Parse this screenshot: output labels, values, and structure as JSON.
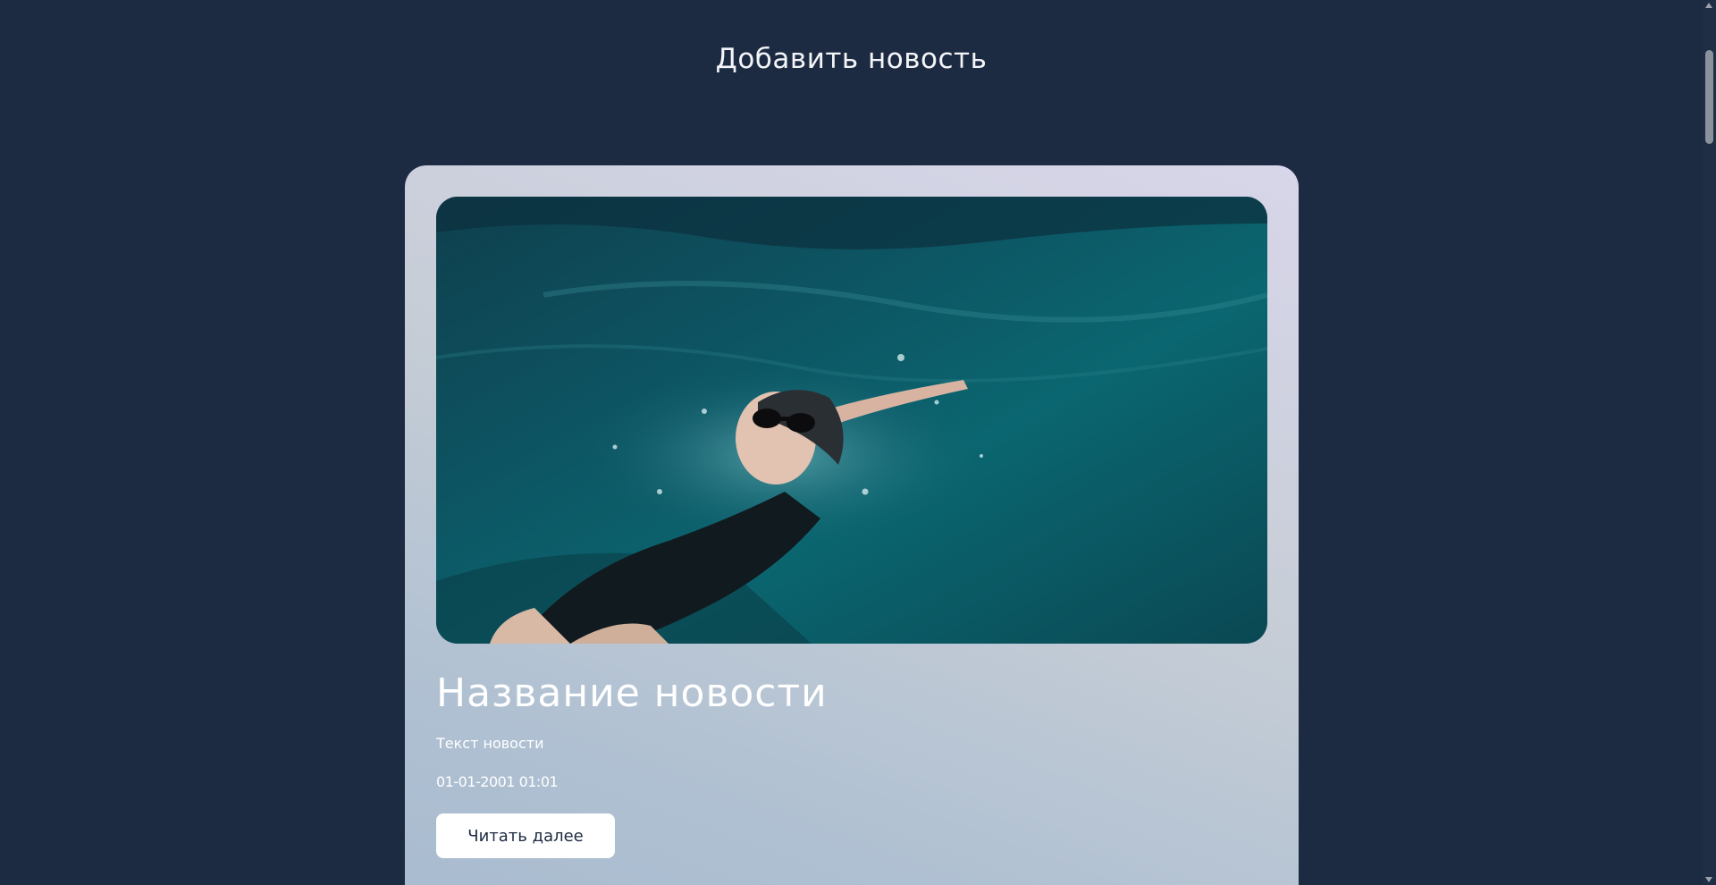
{
  "header": {
    "add_news_label": "Добавить новость"
  },
  "news_card": {
    "image_icon": "swimmer-photo",
    "title": "Название новости",
    "text": "Текст новости",
    "date": "01-01-2001 01:01",
    "read_more_label": "Читать далее"
  },
  "colors": {
    "background": "#1d2b42",
    "card_gradient_start": "#d8d6ea",
    "card_gradient_end": "#a9bbcf",
    "button_bg": "#ffffff",
    "button_text": "#1d2b42",
    "water": "#0e5a66"
  }
}
